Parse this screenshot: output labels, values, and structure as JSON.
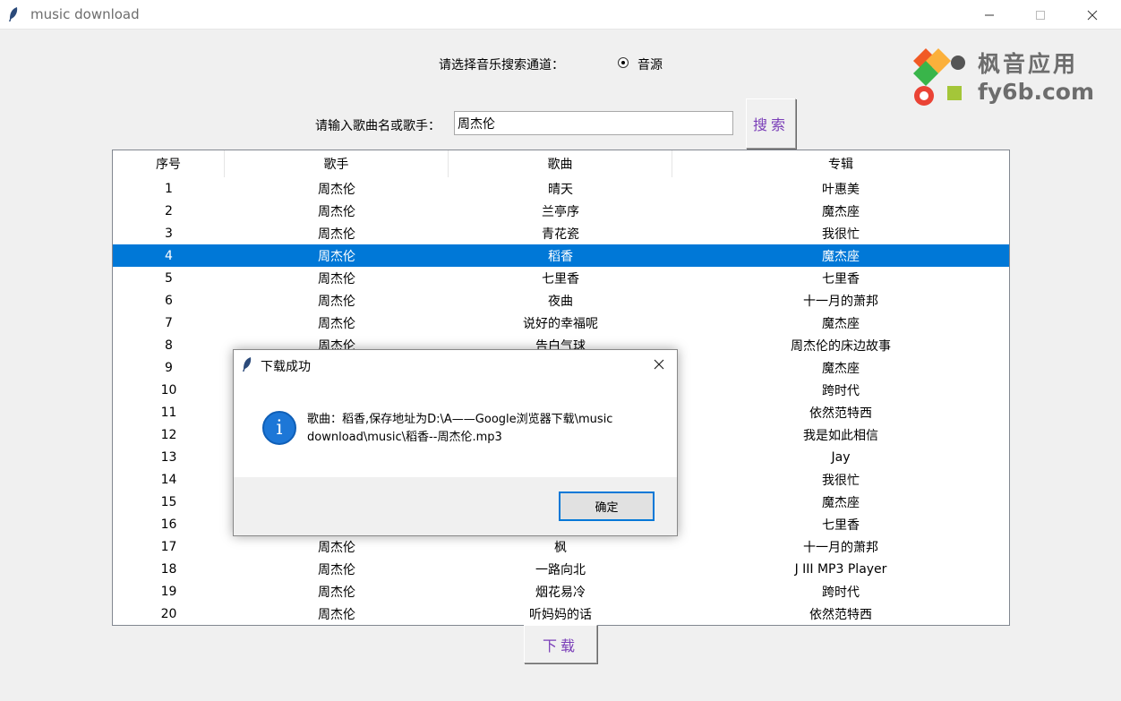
{
  "window": {
    "title": "music download"
  },
  "search_channel": {
    "label": "请选择音乐搜索通道：",
    "option": "音源",
    "selected": true
  },
  "logo": {
    "line1": "枫音应用",
    "line2": "fy6b.com"
  },
  "search": {
    "label": "请输入歌曲名或歌手：",
    "value": "周杰伦",
    "button": "搜索"
  },
  "table": {
    "columns": [
      "序号",
      "歌手",
      "歌曲",
      "专辑"
    ],
    "selected_row": 3,
    "rows": [
      [
        "1",
        "周杰伦",
        "晴天",
        "叶惠美"
      ],
      [
        "2",
        "周杰伦",
        "兰亭序",
        "魔杰座"
      ],
      [
        "3",
        "周杰伦",
        "青花瓷",
        "我很忙"
      ],
      [
        "4",
        "周杰伦",
        "稻香",
        "魔杰座"
      ],
      [
        "5",
        "周杰伦",
        "七里香",
        "七里香"
      ],
      [
        "6",
        "周杰伦",
        "夜曲",
        "十一月的萧邦"
      ],
      [
        "7",
        "周杰伦",
        "说好的幸福呢",
        "魔杰座"
      ],
      [
        "8",
        "周杰伦",
        "告白气球",
        "周杰伦的床边故事"
      ],
      [
        "9",
        "",
        "",
        "魔杰座"
      ],
      [
        "10",
        "",
        "",
        "跨时代"
      ],
      [
        "11",
        "",
        "",
        "依然范特西"
      ],
      [
        "12",
        "",
        "",
        "我是如此相信"
      ],
      [
        "13",
        "",
        "",
        "Jay"
      ],
      [
        "14",
        "",
        "",
        "我很忙"
      ],
      [
        "15",
        "",
        "",
        "魔杰座"
      ],
      [
        "16",
        "",
        "",
        "七里香"
      ],
      [
        "17",
        "周杰伦",
        "枫",
        "十一月的萧邦"
      ],
      [
        "18",
        "周杰伦",
        "一路向北",
        "J III MP3 Player"
      ],
      [
        "19",
        "周杰伦",
        "烟花易冷",
        "跨时代"
      ],
      [
        "20",
        "周杰伦",
        "听妈妈的话",
        "依然范特西"
      ]
    ]
  },
  "download_button": "下载",
  "dialog": {
    "title": "下载成功",
    "message": "歌曲：稻香,保存地址为D:\\A——Google浏览器下载\\music download\\music\\稻香--周杰伦.mp3",
    "ok": "确定"
  },
  "colors": {
    "selection": "#0078d7",
    "accent_text": "#7a3eb8",
    "info_icon": "#1d77d7"
  }
}
